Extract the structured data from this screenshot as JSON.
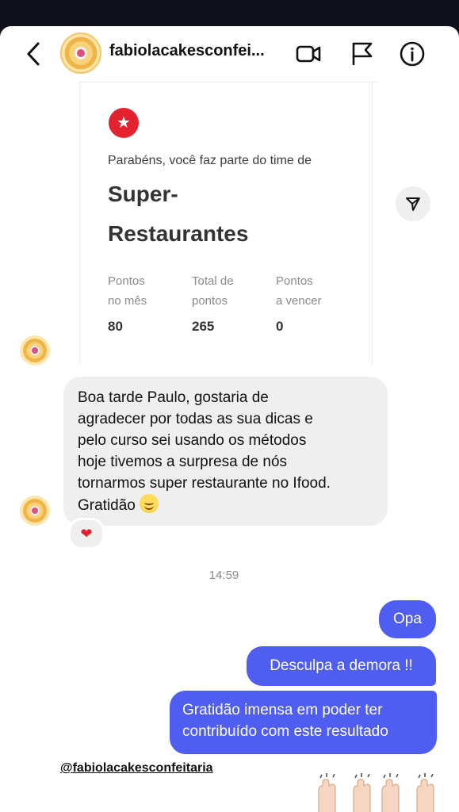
{
  "header": {
    "username": "fabiolacakesconfei...",
    "icons": [
      "back-arrow-icon",
      "video-call-icon",
      "flag-icon",
      "info-icon"
    ]
  },
  "shared_post": {
    "badge_icon": "star-icon",
    "congrats_text": "Parabéns, você faz parte do time de",
    "title_line1": "Super-",
    "title_line2": "Restaurantes",
    "stats": [
      {
        "label_line1": "Pontos",
        "label_line2": "no mês",
        "value": "80"
      },
      {
        "label_line1": "Total de",
        "label_line2": "pontos",
        "value": "265"
      },
      {
        "label_line1": "Pontos",
        "label_line2": "a vencer",
        "value": "0"
      }
    ]
  },
  "incoming_message": {
    "lines": [
      "Boa tarde Paulo, gostaria de",
      "agradecer por todas as sua dicas e",
      "pelo curso sei usando os métodos",
      "hoje tivemos a surpresa de nós",
      "tornarmos super restaurante no Ifood.",
      "Gratidão"
    ],
    "reaction": "❤"
  },
  "timestamp": "14:59",
  "outgoing_messages": [
    {
      "text": "Opa"
    },
    {
      "text": "Desculpa a demora !!"
    },
    {
      "line1": "Gratidão imensa em poder ter",
      "line2": "contribuído com este resultado"
    }
  ],
  "mention": "@fabiolacakesconfeitaria",
  "colors": {
    "outgoing_bubble": "#4f5ef0",
    "incoming_bubble": "#efefef",
    "badge_red": "#e4222f",
    "page_background": "#0f111a"
  }
}
